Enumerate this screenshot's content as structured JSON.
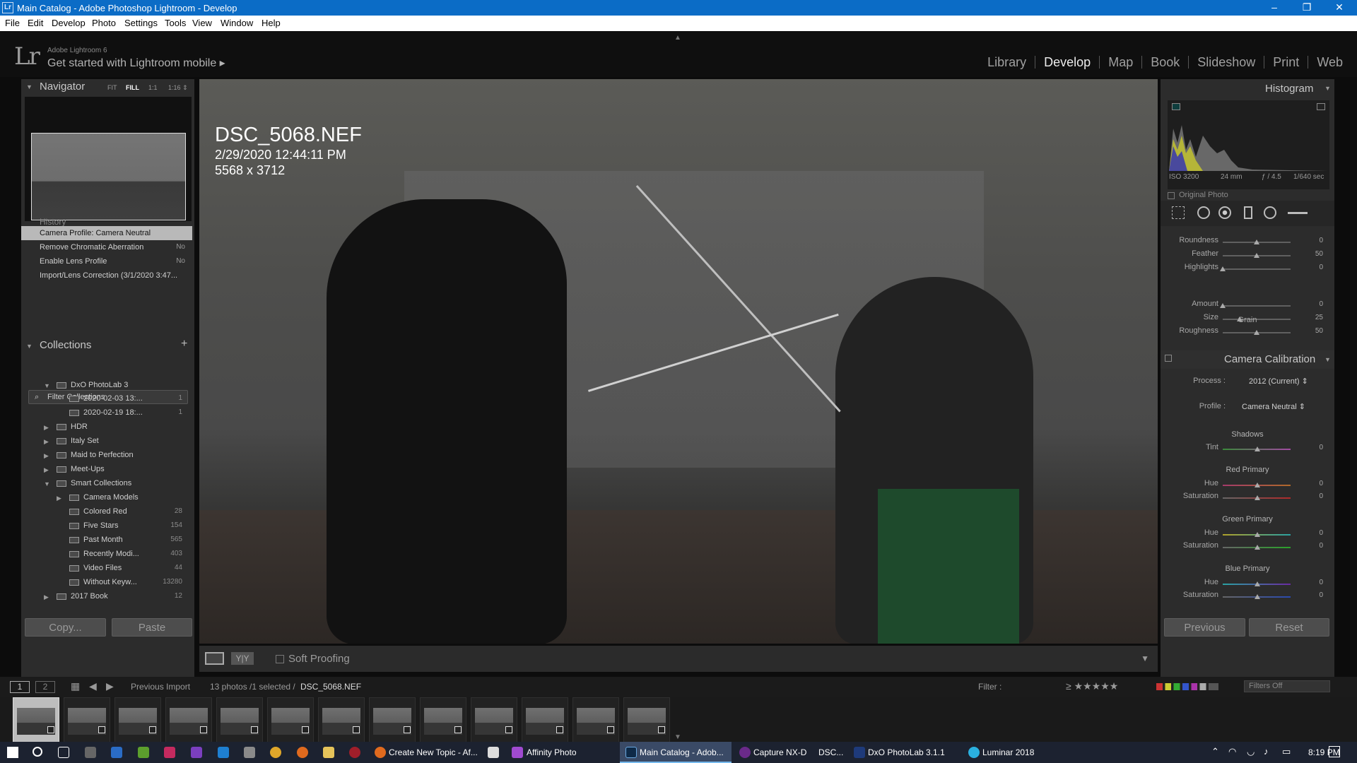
{
  "window": {
    "title": "Main Catalog - Adobe Photoshop Lightroom - Develop",
    "app_icon": "Lr",
    "minimize": "–",
    "maximize": "❐",
    "close": "✕"
  },
  "menu": [
    "File",
    "Edit",
    "Develop",
    "Photo",
    "Settings",
    "Tools",
    "View",
    "Window",
    "Help"
  ],
  "identity": {
    "logo": "Lr",
    "version": "Adobe Lightroom 6",
    "mobile": "Get started with Lightroom mobile ▸"
  },
  "modules": [
    "Library",
    "Develop",
    "Map",
    "Book",
    "Slideshow",
    "Print",
    "Web"
  ],
  "active_module": "Develop",
  "navigator": {
    "title": "Navigator",
    "zoom": [
      "FIT",
      "FILL",
      "1:1",
      "1:16 ⇕"
    ]
  },
  "history": {
    "title": "History",
    "items": [
      {
        "label": "Camera Profile: Camera Neutral",
        "value": ""
      },
      {
        "label": "Remove Chromatic Aberration",
        "value": "No"
      },
      {
        "label": "Enable Lens Profile",
        "value": "No"
      },
      {
        "label": "Import/Lens Correction (3/1/2020 3:47...",
        "value": ""
      }
    ]
  },
  "collections": {
    "title": "Collections",
    "add": "+",
    "filter_placeholder": "Filter Collections",
    "items": [
      {
        "label": "DxO PhotoLab 3",
        "count": "",
        "expand": "▼"
      },
      {
        "label": "2020-02-03 13:...",
        "count": "1",
        "expand": ""
      },
      {
        "label": "2020-02-19 18:...",
        "count": "1",
        "expand": ""
      },
      {
        "label": "HDR",
        "count": "",
        "expand": "▶"
      },
      {
        "label": "Italy Set",
        "count": "",
        "expand": "▶"
      },
      {
        "label": "Maid to Perfection",
        "count": "",
        "expand": "▶"
      },
      {
        "label": "Meet-Ups",
        "count": "",
        "expand": "▶"
      },
      {
        "label": "Smart Collections",
        "count": "",
        "expand": "▼"
      },
      {
        "label": "Camera Models",
        "count": "",
        "expand": "▶"
      },
      {
        "label": "Colored Red",
        "count": "28",
        "expand": ""
      },
      {
        "label": "Five Stars",
        "count": "154",
        "expand": ""
      },
      {
        "label": "Past Month",
        "count": "565",
        "expand": ""
      },
      {
        "label": "Recently Modi...",
        "count": "403",
        "expand": ""
      },
      {
        "label": "Video Files",
        "count": "44",
        "expand": ""
      },
      {
        "label": "Without Keyw...",
        "count": "13280",
        "expand": ""
      },
      {
        "label": "2017 Book",
        "count": "12",
        "expand": "▶"
      }
    ]
  },
  "left_buttons": {
    "copy": "Copy...",
    "paste": "Paste"
  },
  "photo": {
    "filename": "DSC_5068.NEF",
    "datetime": "2/29/2020 12:44:11 PM",
    "dimensions": "5568 x 3712"
  },
  "toolbar": {
    "soft_proofing": "Soft Proofing",
    "yy": "Y|Y"
  },
  "histogram": {
    "title": "Histogram",
    "iso": "ISO 3200",
    "focal": "24 mm",
    "aperture": "ƒ / 4.5",
    "shutter": "1/640 sec",
    "original_photo": "Original Photo"
  },
  "effects": {
    "rows": [
      {
        "label": "Roundness",
        "value": "0",
        "pos": 0.5
      },
      {
        "label": "Feather",
        "value": "50",
        "pos": 0.5
      },
      {
        "label": "Highlights",
        "value": "0",
        "pos": 0.0
      }
    ],
    "grain_title": "Grain",
    "grain": [
      {
        "label": "Amount",
        "value": "0",
        "pos": 0.0
      },
      {
        "label": "Size",
        "value": "25",
        "pos": 0.25
      },
      {
        "label": "Roughness",
        "value": "50",
        "pos": 0.5
      }
    ]
  },
  "calibration": {
    "title": "Camera Calibration",
    "process_label": "Process :",
    "process_value": "2012 (Current) ⇕",
    "profile_label": "Profile :",
    "profile_value": "Camera Neutral ⇕",
    "shadows_title": "Shadows",
    "tint": {
      "label": "Tint",
      "value": "0"
    },
    "red_title": "Red Primary",
    "green_title": "Green Primary",
    "blue_title": "Blue Primary",
    "hue_label": "Hue",
    "sat_label": "Saturation",
    "zero": "0"
  },
  "right_buttons": {
    "previous": "Previous",
    "reset": "Reset"
  },
  "filmstrip": {
    "screen1": "1",
    "screen2": "2",
    "source": "Previous Import",
    "count": "13 photos /1 selected /",
    "file": "DSC_5068.NEF",
    "filter_label": "Filter :",
    "filters_off": "Filters Off",
    "stars": "≥ ★★★★★"
  },
  "taskbar": {
    "items": [
      "Create New Topic - Af...",
      "Affinity Photo",
      "Main Catalog - Adob...",
      "Capture NX-D",
      "DSC...",
      "DxO PhotoLab 3.1.1",
      "Luminar 2018"
    ],
    "time": "8:19 PM"
  }
}
